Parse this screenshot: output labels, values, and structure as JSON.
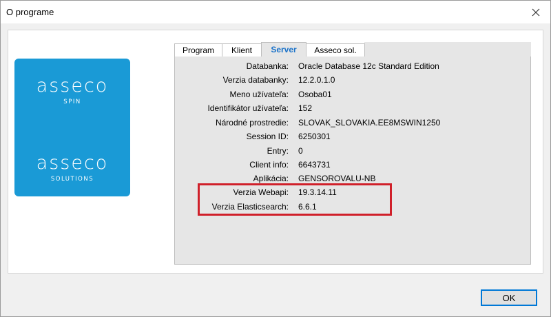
{
  "window": {
    "title": "O programe"
  },
  "logo": {
    "line1": "asseco",
    "sub1": "SPIN",
    "line2": "asseco",
    "sub2": "SOLUTIONS"
  },
  "tabs": [
    {
      "label": "Program",
      "active": false
    },
    {
      "label": "Klient",
      "active": false
    },
    {
      "label": "Server",
      "active": true
    },
    {
      "label": "Asseco sol.",
      "active": false
    }
  ],
  "server_info": [
    {
      "label": "Databanka:",
      "value": "Oracle Database 12c Standard Edition"
    },
    {
      "label": "Verzia databanky:",
      "value": "12.2.0.1.0"
    },
    {
      "label": "Meno užívateľa:",
      "value": "Osoba01"
    },
    {
      "label": "Identifikátor užívateľa:",
      "value": "152"
    },
    {
      "label": "Národné prostredie:",
      "value": "SLOVAK_SLOVAKIA.EE8MSWIN1250"
    },
    {
      "label": "Session ID:",
      "value": "6250301"
    },
    {
      "label": "Entry:",
      "value": "0"
    },
    {
      "label": "Client info:",
      "value": "6643731"
    },
    {
      "label": "Aplikácia:",
      "value": "GENSOROVALU-NB"
    },
    {
      "label": "Verzia Webapi:",
      "value": "19.3.14.11"
    },
    {
      "label": "Verzia Elasticsearch:",
      "value": "6.6.1"
    }
  ],
  "buttons": {
    "ok": "OK"
  },
  "colors": {
    "logo_bg": "#1a9ad6",
    "active_tab_text": "#1a72c9",
    "highlight": "#d0202a",
    "ok_border": "#0078d7"
  }
}
